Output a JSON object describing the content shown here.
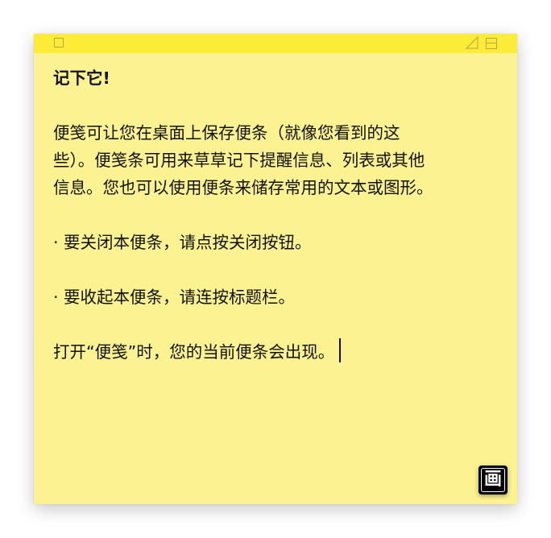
{
  "note": {
    "background_color": "#fdf291",
    "titlebar_color": "#fceb37",
    "titlebar": {
      "close_icon": "square-close-icon",
      "resize_icon": "triangle-resize-icon",
      "collapse_icon": "window-collapse-icon"
    },
    "heading": "记下它!",
    "paragraph_lines": [
      "便笺可让您在桌面上保存便条（就像您看到的这",
      "些）。便笺条可用来草草记下提醒信息、列表或其他",
      "信息。您也可以使用便条来储存常用的文本或图形。"
    ],
    "bullet_close": "· 要关闭本便条，请点按关闭按钮。",
    "bullet_collapse": "· 要收起本便条，请连按标题栏。",
    "closing_line": "打开“便笺”时，您的当前便条会出现。",
    "draw_button_glyph": "画"
  }
}
